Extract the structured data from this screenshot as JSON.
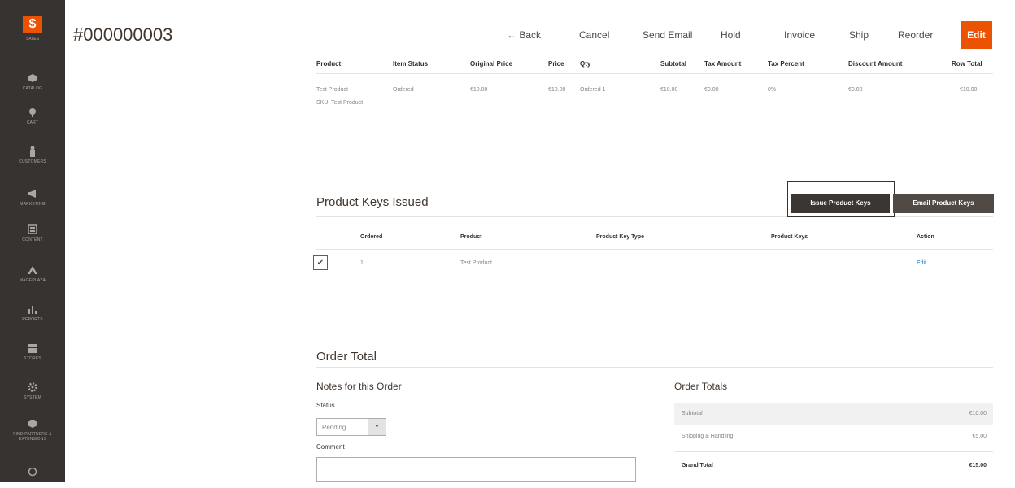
{
  "sidebar": {
    "logo_glyph": "$",
    "logo_label": "SALES",
    "items": [
      {
        "label": "CATALOG",
        "icon": "cube-icon"
      },
      {
        "label": "CART",
        "icon": "cart-icon"
      },
      {
        "label": "CUSTOMERS",
        "icon": "person-icon"
      },
      {
        "label": "MARKETING",
        "icon": "megaphone-icon"
      },
      {
        "label": "CONTENT",
        "icon": "layout-icon"
      },
      {
        "label": "MAGEPLAZA",
        "icon": "mageplaza-icon"
      },
      {
        "label": "REPORTS",
        "icon": "bar-chart-icon"
      },
      {
        "label": "STORES",
        "icon": "store-icon"
      },
      {
        "label": "SYSTEM",
        "icon": "gear-icon"
      },
      {
        "label": "FIND PARTNERS & EXTENSIONS",
        "icon": "extensions-icon"
      },
      {
        "label": "",
        "icon": "circle-icon"
      }
    ]
  },
  "header": {
    "title": "#000000003",
    "back": "Back",
    "cancel": "Cancel",
    "send_email": "Send Email",
    "hold": "Hold",
    "invoice": "Invoice",
    "ship": "Ship",
    "reorder": "Reorder",
    "edit": "Edit"
  },
  "items_table": {
    "headers": [
      "Product",
      "Item Status",
      "Original Price",
      "Price",
      "Qty",
      "Subtotal",
      "Tax Amount",
      "Tax Percent",
      "Discount Amount",
      "Row Total"
    ],
    "row": {
      "product": "Test Product",
      "sku": "SKU: Test Product",
      "status": "Ordered",
      "original_price": "€10.00",
      "price": "€10.00",
      "qty": "Ordered 1",
      "subtotal": "€10.00",
      "tax_amount": "€0.00",
      "tax_percent": "0%",
      "discount": "€0.00",
      "row_total": "€10.00"
    }
  },
  "keys": {
    "title": "Product Keys Issued",
    "issue_btn": "Issue Product Keys",
    "email_btn": "Email Product Keys",
    "headers": [
      "Ordered",
      "Product",
      "Product Key Type",
      "Product Keys",
      "Action"
    ],
    "row": {
      "checked": true,
      "ordered": "1",
      "product": "Test Product",
      "key_type": "",
      "keys": "",
      "action": "Edit"
    }
  },
  "order_total": {
    "title": "Order Total",
    "notes_title": "Notes for this Order",
    "status_label": "Status",
    "status_value": "Pending",
    "comment_label": "Comment",
    "totals_title": "Order Totals",
    "rows": [
      {
        "label": "Subtotal",
        "value": "€10.00"
      },
      {
        "label": "Shipping & Handling",
        "value": "€5.00"
      },
      {
        "label": "Grand Total",
        "value": "€15.00"
      }
    ]
  },
  "colors": {
    "accent": "#eb5202",
    "sidebar": "#373330",
    "dark_button": "#514943"
  }
}
